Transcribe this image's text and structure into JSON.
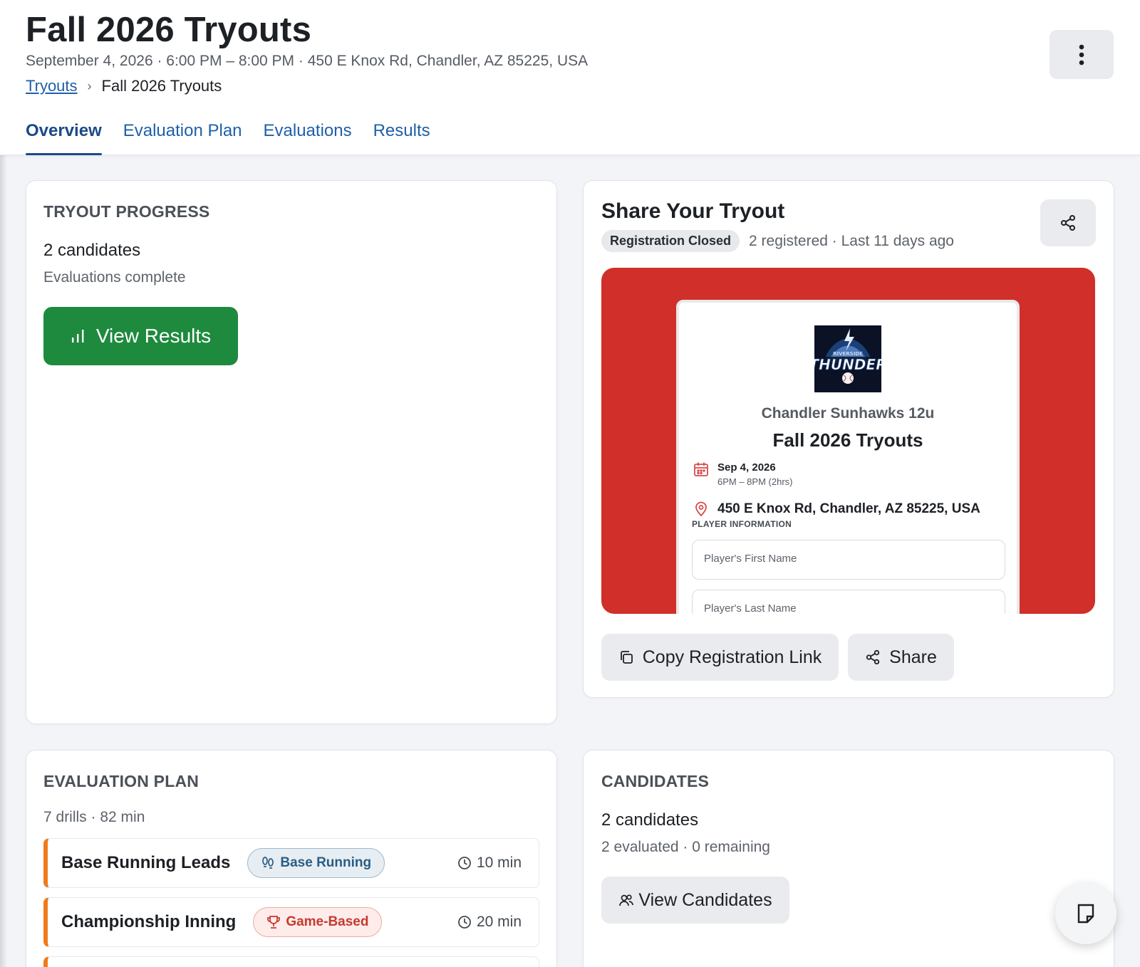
{
  "header": {
    "title": "Fall 2026 Tryouts",
    "subtitle": "September 4, 2026 · 6:00 PM – 8:00 PM · 450 E Knox Rd, Chandler, AZ 85225, USA",
    "breadcrumb": {
      "root": "Tryouts",
      "separator": "›",
      "current": "Fall 2026 Tryouts"
    },
    "more_icon": "more-vertical-icon"
  },
  "tabs": [
    {
      "label": "Overview",
      "active": true
    },
    {
      "label": "Evaluation Plan",
      "active": false
    },
    {
      "label": "Evaluations",
      "active": false
    },
    {
      "label": "Results",
      "active": false
    }
  ],
  "progress": {
    "heading": "TRYOUT PROGRESS",
    "count": "2 candidates",
    "status": "Evaluations complete",
    "button": "View Results",
    "button_icon": "bar-chart-icon",
    "button_color": "#1e8a3e"
  },
  "share": {
    "title": "Share Your Tryout",
    "badge": "Registration Closed",
    "meta": "2 registered · Last 11 days ago",
    "share_icon": "share-icon",
    "preview": {
      "background": "#d02f2a",
      "logo_text_top": "RIVERSIDE",
      "logo_text_main": "THUNDER",
      "team": "Chandler Sunhawks 12u",
      "title": "Fall 2026 Tryouts",
      "date": "Sep 4, 2026",
      "time": "6PM – 8PM (2hrs)",
      "location": "450 E Knox Rd, Chandler, AZ 85225, USA",
      "section": "PLAYER INFORMATION",
      "first_name_placeholder": "Player's First Name",
      "last_name_placeholder": "Player's Last Name"
    },
    "copy_button": "Copy Registration Link",
    "share_button": "Share"
  },
  "plan": {
    "heading": "EVALUATION PLAN",
    "summary": "7 drills · 82 min",
    "drills": [
      {
        "name": "Base Running Leads",
        "category": "Base Running",
        "duration": "10 min"
      },
      {
        "name": "Championship Inning",
        "category": "Game-Based",
        "duration": "20 min"
      }
    ]
  },
  "candidates": {
    "heading": "CANDIDATES",
    "count": "2 candidates",
    "status": "2 evaluated · 0 remaining",
    "button": "View Candidates"
  },
  "fab_icon": "note-icon"
}
